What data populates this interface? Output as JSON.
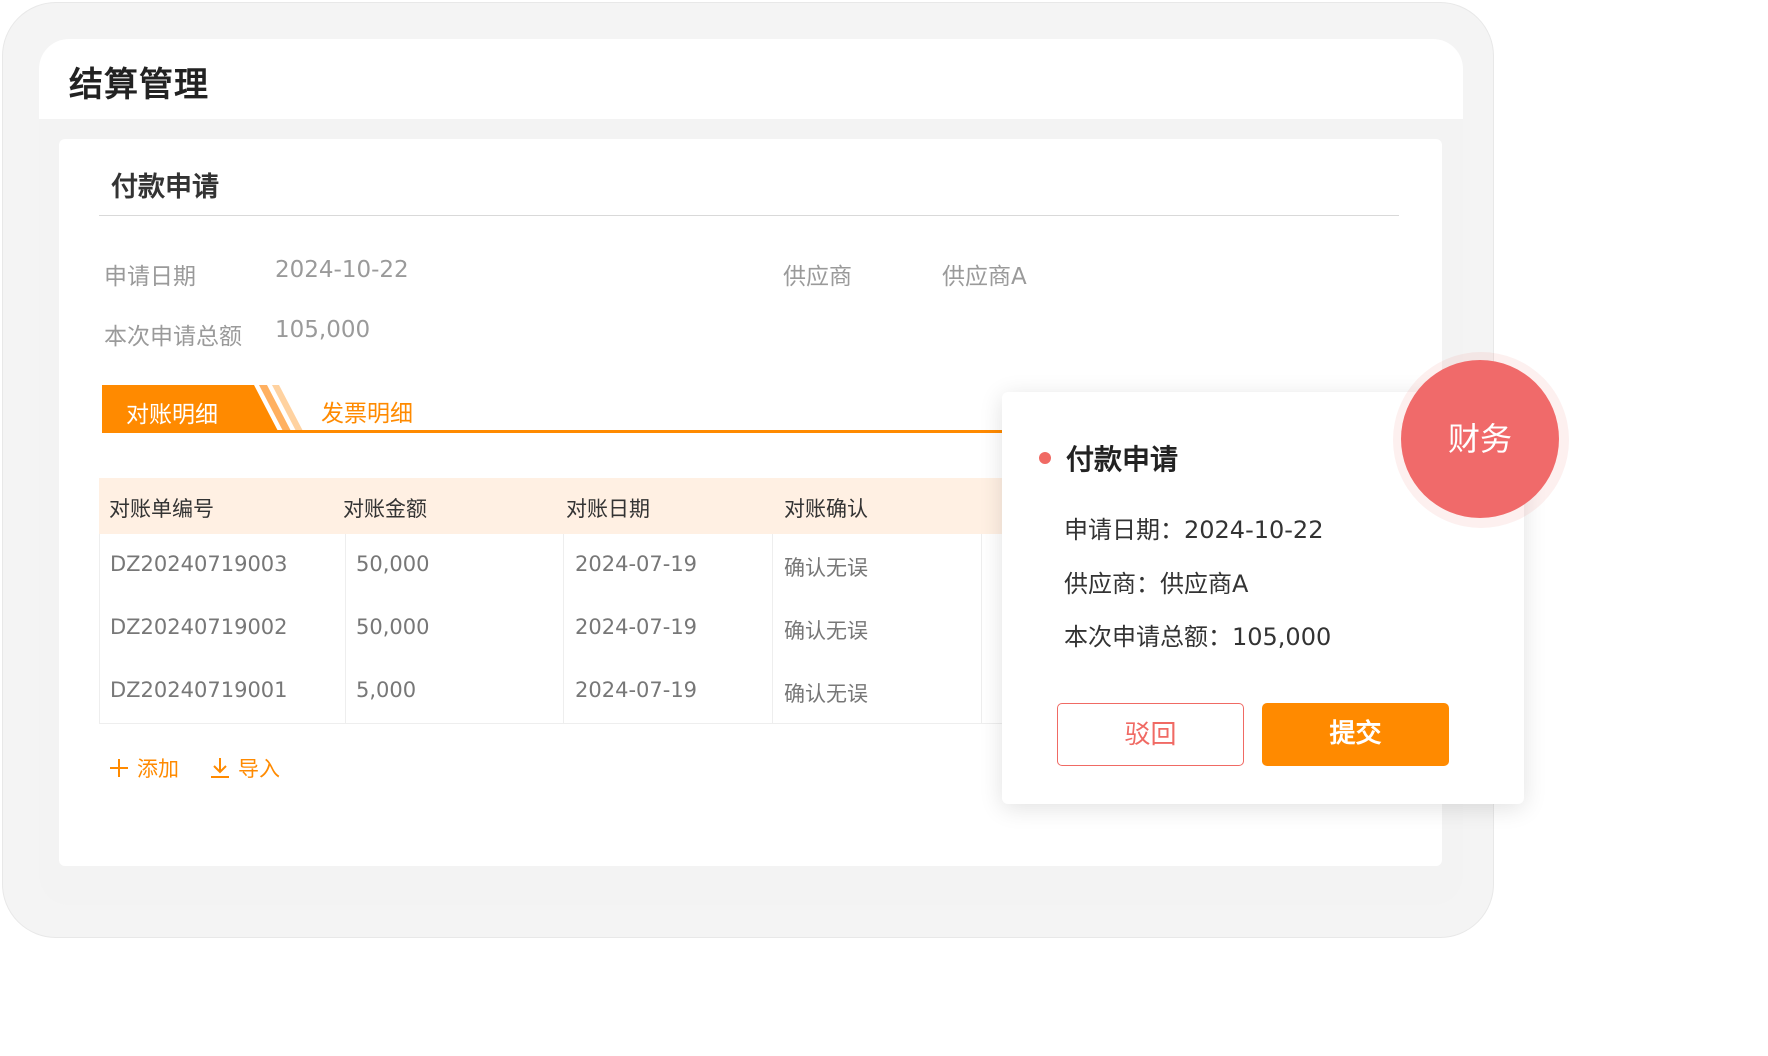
{
  "app": {
    "title": "结算管理"
  },
  "form": {
    "section_title": "付款申请",
    "apply_date_label": "申请日期",
    "apply_date_value": "2024-10-22",
    "supplier_label": "供应商",
    "supplier_value": "供应商A",
    "total_label": "本次申请总额",
    "total_value": "105,000"
  },
  "tabs": [
    {
      "label": "对账明细",
      "active": true
    },
    {
      "label": "发票明细",
      "active": false
    }
  ],
  "table": {
    "headers": [
      "对账单编号",
      "对账金额",
      "对账日期",
      "对账确认"
    ],
    "rows": [
      [
        "DZ20240719003",
        "50,000",
        "2024-07-19",
        "确认无误"
      ],
      [
        "DZ20240719002",
        "50,000",
        "2024-07-19",
        "确认无误"
      ],
      [
        "DZ20240719001",
        "5,000",
        "2024-07-19",
        "确认无误"
      ]
    ]
  },
  "actions": {
    "add_label": "添加",
    "import_label": "导入"
  },
  "popup": {
    "title": "付款申请",
    "date_line": "申请日期：2024-10-22",
    "supplier_line": "供应商：供应商A",
    "total_line": "本次申请总额：105,000",
    "reject_label": "驳回",
    "submit_label": "提交"
  },
  "role_badge": {
    "label": "财务"
  },
  "colors": {
    "accent": "#ff8a00",
    "table_header_bg": "#fff0e3",
    "reject": "#f06a64",
    "badge": "#f06a6a"
  }
}
